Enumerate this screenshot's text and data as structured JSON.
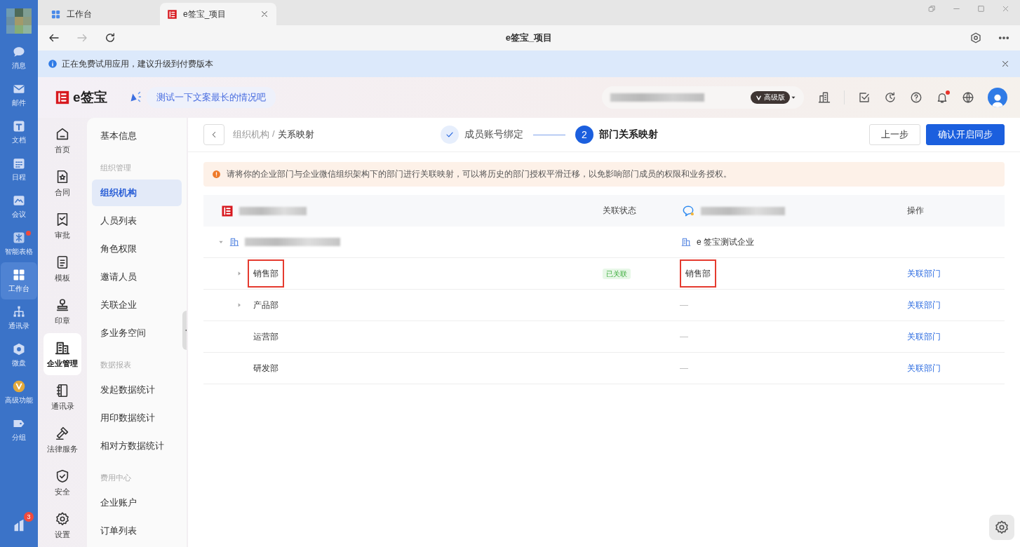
{
  "app_rail": {
    "items": [
      {
        "label": "消息",
        "selected": false,
        "dot": false
      },
      {
        "label": "邮件",
        "selected": false,
        "dot": false
      },
      {
        "label": "文档",
        "selected": false,
        "dot": false
      },
      {
        "label": "日程",
        "selected": false,
        "dot": false
      },
      {
        "label": "会议",
        "selected": false,
        "dot": false
      },
      {
        "label": "智能表格",
        "selected": false,
        "dot": true
      },
      {
        "label": "工作台",
        "selected": true,
        "dot": false
      },
      {
        "label": "通讯录",
        "selected": false,
        "dot": false
      },
      {
        "label": "微盘",
        "selected": false,
        "dot": false
      },
      {
        "label": "高级功能",
        "selected": false,
        "dot": false
      },
      {
        "label": "分组",
        "selected": false,
        "dot": false
      }
    ],
    "bottom_badge": "3"
  },
  "browser": {
    "tabs": [
      {
        "label": "工作台",
        "selected": false
      },
      {
        "label": "e签宝_项目",
        "selected": true
      }
    ],
    "page_title": "e签宝_项目",
    "notice": "正在免费试用应用，建议升级到付费版本"
  },
  "header": {
    "logo": "e签宝",
    "announcement": "测试一下文案最长的情况吧",
    "plan_badge": "高级版",
    "notification_dot": true
  },
  "side_nav": {
    "items": [
      {
        "label": "首页",
        "selected": false
      },
      {
        "label": "合同",
        "selected": false
      },
      {
        "label": "审批",
        "selected": false
      },
      {
        "label": "模板",
        "selected": false
      },
      {
        "label": "印章",
        "selected": false
      },
      {
        "label": "企业管理",
        "selected": true
      },
      {
        "label": "通讯录",
        "selected": false
      },
      {
        "label": "法律服务",
        "selected": false
      },
      {
        "label": "安全",
        "selected": false
      },
      {
        "label": "设置",
        "selected": false
      }
    ]
  },
  "menu": {
    "sections": [
      {
        "items": [
          {
            "label": "基本信息",
            "selected": false
          }
        ]
      },
      {
        "title": "组织管理",
        "items": [
          {
            "label": "组织机构",
            "selected": true
          },
          {
            "label": "人员列表",
            "selected": false
          },
          {
            "label": "角色权限",
            "selected": false
          },
          {
            "label": "邀请人员",
            "selected": false
          },
          {
            "label": "关联企业",
            "selected": false
          },
          {
            "label": "多业务空间",
            "selected": false
          }
        ]
      },
      {
        "title": "数据报表",
        "items": [
          {
            "label": "发起数据统计",
            "selected": false
          },
          {
            "label": "用印数据统计",
            "selected": false
          },
          {
            "label": "相对方数据统计",
            "selected": false
          }
        ]
      },
      {
        "title": "费用中心",
        "items": [
          {
            "label": "企业账户",
            "selected": false
          },
          {
            "label": "订单列表",
            "selected": false
          }
        ]
      }
    ]
  },
  "page": {
    "breadcrumb": {
      "items": [
        "组织机构",
        "关系映射"
      ],
      "separator": "/"
    },
    "steps": [
      {
        "label": "成员账号绑定",
        "done": true,
        "current": false
      },
      {
        "number": "2",
        "label": "部门关系映射",
        "done": false,
        "current": true
      }
    ],
    "buttons": [
      {
        "label": "上一步",
        "primary": false
      },
      {
        "label": "确认开启同步",
        "primary": true
      }
    ],
    "alert": "请将你的企业部门与企业微信组织架构下的部门进行关联映射，可以将历史的部门授权平滑迁移，以免影响部门成员的权限和业务授权。",
    "table": {
      "columns": [
        "关联状态",
        "操作"
      ],
      "rows": [
        {
          "expanded": true,
          "mapped": "e 签宝测试企业",
          "children": [
            {
              "name": "销售部",
              "expandable": true,
              "status": "已关联",
              "mapped": "销售部",
              "highlighted": true,
              "action": "关联部门"
            },
            {
              "name": "产品部",
              "expandable": true,
              "mapped": "—",
              "highlighted": false,
              "action": "关联部门"
            },
            {
              "name": "运营部",
              "expandable": false,
              "mapped": "—",
              "highlighted": false,
              "action": "关联部门"
            },
            {
              "name": "研发部",
              "expandable": false,
              "mapped": "—",
              "highlighted": false,
              "action": "关联部门"
            }
          ]
        }
      ]
    }
  }
}
